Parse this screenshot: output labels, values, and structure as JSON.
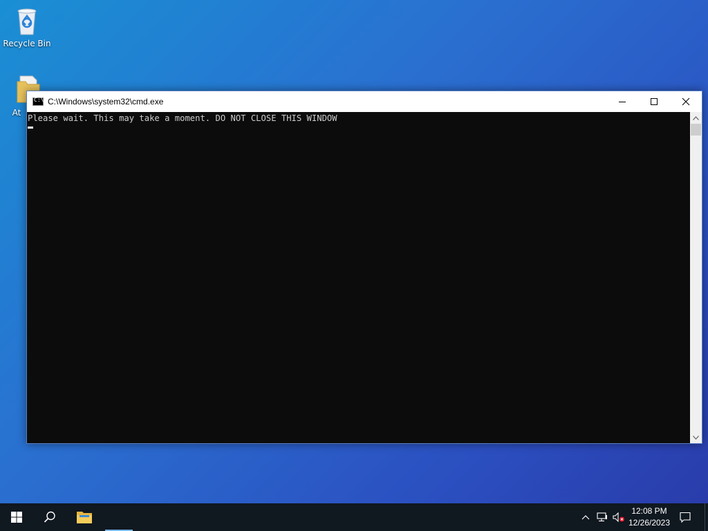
{
  "desktop": {
    "icons": [
      {
        "label": "Recycle Bin",
        "icon": "recycle-bin-icon"
      },
      {
        "label": "At",
        "icon": "folder-icon"
      }
    ]
  },
  "window": {
    "title": "C:\\Windows\\system32\\cmd.exe",
    "icon": "console-icon",
    "icon_text": "C:\\",
    "minimize": "minimize-icon",
    "maximize": "maximize-icon",
    "close": "close-icon"
  },
  "console": {
    "lines": [
      "Please wait. This may take a moment. DO NOT CLOSE THIS WINDOW"
    ]
  },
  "taskbar": {
    "start": "windows-logo-icon",
    "search": "search-icon",
    "pinned": [
      {
        "icon": "file-explorer-icon",
        "active": true
      }
    ],
    "tray": {
      "chevron": "chevron-up-icon",
      "network": "network-icon",
      "volume": "volume-muted-icon",
      "notifications": "notification-icon"
    },
    "clock": {
      "time": "12:08 PM",
      "date": "12/26/2023"
    }
  },
  "colors": {
    "console_bg": "#0c0c0c",
    "console_text": "#cccccc",
    "taskbar_bg": "#101820",
    "accent": "#76b9ed"
  }
}
